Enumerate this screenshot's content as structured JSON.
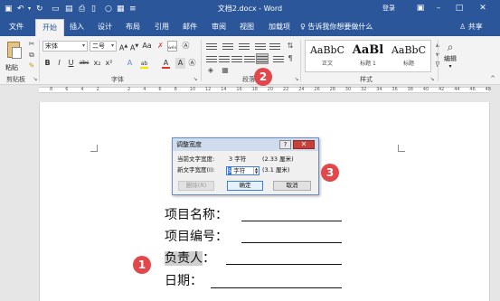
{
  "window": {
    "title": "文档2.docx - Word",
    "login_label": "登录",
    "accent": "#2b579a"
  },
  "tabs": [
    "文件",
    "开始",
    "插入",
    "设计",
    "布局",
    "引用",
    "邮件",
    "审阅",
    "视图",
    "加载项"
  ],
  "active_tab": "开始",
  "tell_me": "告诉我你想要做什么",
  "share_label": "共享",
  "ribbon": {
    "clipboard": {
      "paste_label": "粘贴",
      "group_label": "剪贴板"
    },
    "font": {
      "font_name": "宋体",
      "font_size": "二号",
      "group_label": "字体",
      "bold": "B",
      "italic": "I",
      "underline": "U",
      "strike": "abc",
      "subscript": "x₂",
      "superscript": "x²",
      "font_color": "A",
      "highlight": "ab",
      "wen": "wén",
      "font_color_hex": "#e1322d",
      "highlight_hex": "#f5e400"
    },
    "paragraph": {
      "group_label": "段落"
    },
    "styles": {
      "group_label": "样式",
      "items": [
        {
          "sample": "AaBbC",
          "name": "正文"
        },
        {
          "sample": "AaBl",
          "name": "标题 1"
        },
        {
          "sample": "AaBbC",
          "name": "标题"
        }
      ]
    },
    "editing": {
      "label": "编辑"
    }
  },
  "ruler_numbers": [
    "8",
    "6",
    "4",
    "2",
    "",
    "2",
    "4",
    "6",
    "8",
    "10",
    "12",
    "14",
    "16",
    "18",
    "20",
    "22",
    "24",
    "26",
    "28",
    "30",
    "32",
    "34",
    "36",
    "38",
    "40",
    "42",
    "44",
    "46",
    "48"
  ],
  "dialog": {
    "title": "调整宽度",
    "help": "?",
    "close": "✕",
    "current_label": "当前文字宽度:",
    "current_value": "3 字符",
    "current_cm": "(2.33 厘米)",
    "new_label": "新文字宽度(I):",
    "new_value_selected": "5",
    "new_value_rest": " 字符",
    "new_cm": "(3.1 厘米)",
    "delete_button": "删除(R)",
    "ok_button": "确定",
    "cancel_button": "取消"
  },
  "document": {
    "lines": [
      {
        "label": "项目名称："
      },
      {
        "label": "项目编号："
      },
      {
        "label": "负责人",
        "suffix": "：",
        "highlighted": true
      },
      {
        "label": "日期："
      }
    ]
  },
  "callouts": [
    "1",
    "2",
    "3"
  ],
  "callout_color": "#e1474b"
}
